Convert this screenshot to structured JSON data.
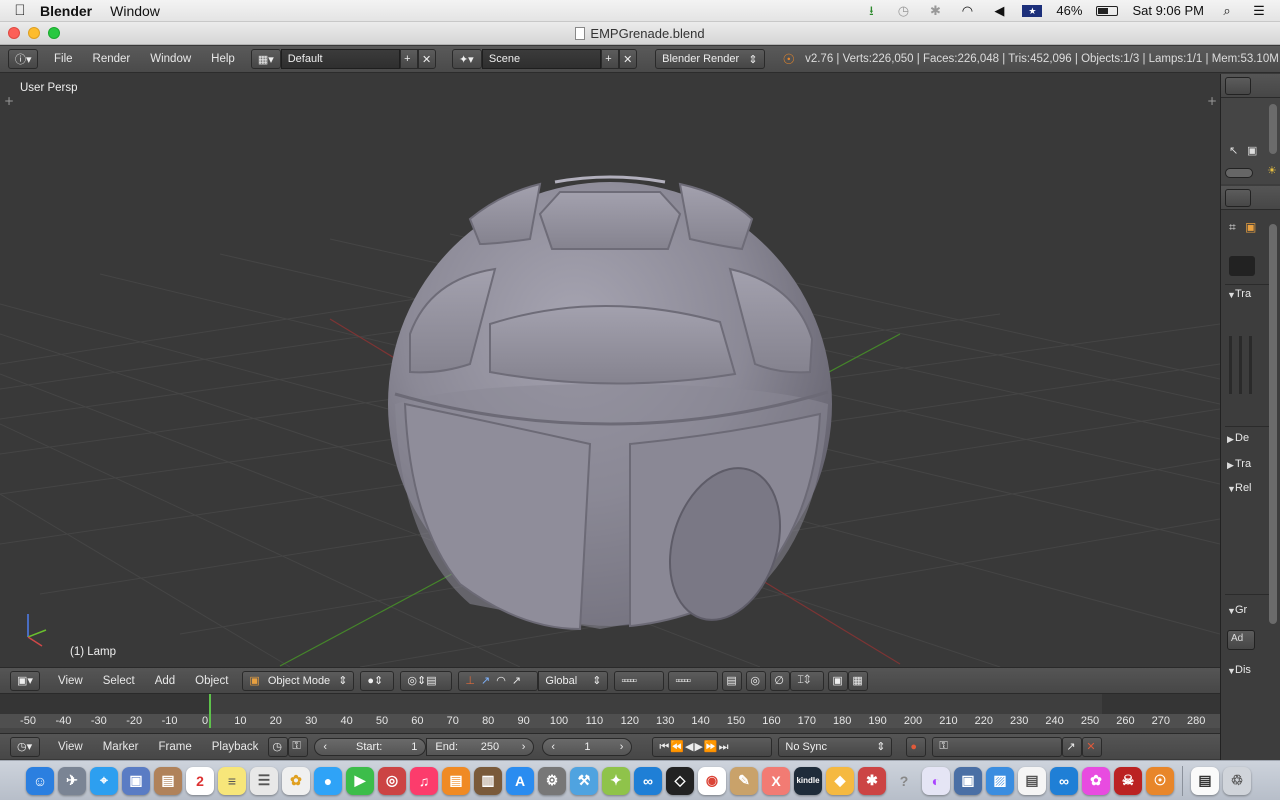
{
  "macos_menubar": {
    "app_name": "Blender",
    "menus": [
      "Window"
    ],
    "battery": "46%",
    "clock": "Sat 9:06 PM"
  },
  "window": {
    "title": "EMPGrenade.blend"
  },
  "info_header": {
    "menus": [
      "File",
      "Render",
      "Window",
      "Help"
    ],
    "layout": "Default",
    "scene": "Scene",
    "render_engine": "Blender Render",
    "stats": "v2.76 | Verts:226,050 | Faces:226,048 | Tris:452,096 | Objects:1/3 | Lamps:1/1 | Mem:53.10M"
  },
  "viewport": {
    "view_name": "User Persp",
    "active_object": "(1) Lamp"
  },
  "viewport_header": {
    "menus": [
      "View",
      "Select",
      "Add",
      "Object"
    ],
    "mode": "Object Mode",
    "orientation": "Global"
  },
  "timeline": {
    "ticks": [
      -50,
      -40,
      -30,
      -20,
      -10,
      0,
      10,
      20,
      30,
      40,
      50,
      60,
      70,
      80,
      90,
      100,
      110,
      120,
      130,
      140,
      150,
      160,
      170,
      180,
      190,
      200,
      210,
      220,
      230,
      240,
      250,
      260,
      270,
      280
    ],
    "current_frame": 1
  },
  "timeline_header": {
    "menus": [
      "View",
      "Marker",
      "Frame",
      "Playback"
    ],
    "start_label": "Start:",
    "start_value": "1",
    "end_label": "End:",
    "end_value": "250",
    "frame_value": "1",
    "sync": "No Sync"
  },
  "properties_panel": {
    "sections": [
      "Tra",
      "De",
      "Tra",
      "Rel",
      "Gr",
      "Dis"
    ],
    "add_button": "Ad"
  },
  "colors": {
    "viewport_bg": "#393939",
    "x_axis": "#8a3a3a",
    "y_axis": "#4f8a2a",
    "mesh": "#8e8c99"
  }
}
